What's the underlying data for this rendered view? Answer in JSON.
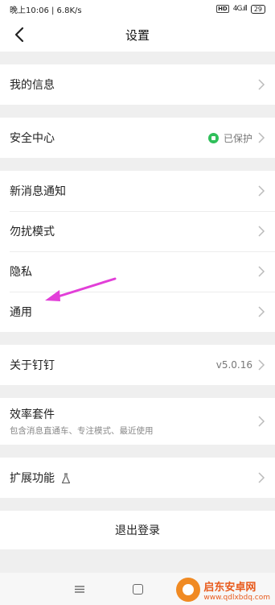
{
  "status_bar": {
    "left": "晚上10:06 | 6.8K/s",
    "hd": "HD",
    "signal": "4G.ıll",
    "battery": "29"
  },
  "nav": {
    "title": "设置",
    "back_icon": "chevron-left-icon"
  },
  "groups": {
    "my_info": {
      "label": "我的信息"
    },
    "security": {
      "label": "安全中心",
      "status": "已保护",
      "status_color": "#2fbf5a"
    },
    "notifications": {
      "label": "新消息通知"
    },
    "dnd": {
      "label": "勿扰模式"
    },
    "privacy": {
      "label": "隐私"
    },
    "general": {
      "label": "通用"
    },
    "about": {
      "label": "关于钉钉",
      "version": "v5.0.16"
    },
    "efficiency": {
      "label": "效率套件",
      "sub": "包含消息直通车、专注模式、最近使用"
    },
    "extensions": {
      "label": "扩展功能",
      "icon": "flask-icon"
    }
  },
  "logout": {
    "label": "退出登录"
  },
  "annotation": {
    "color": "#e23fd8"
  },
  "watermark": {
    "title": "启东安卓网",
    "url": "www.qdlxbdq.com"
  }
}
